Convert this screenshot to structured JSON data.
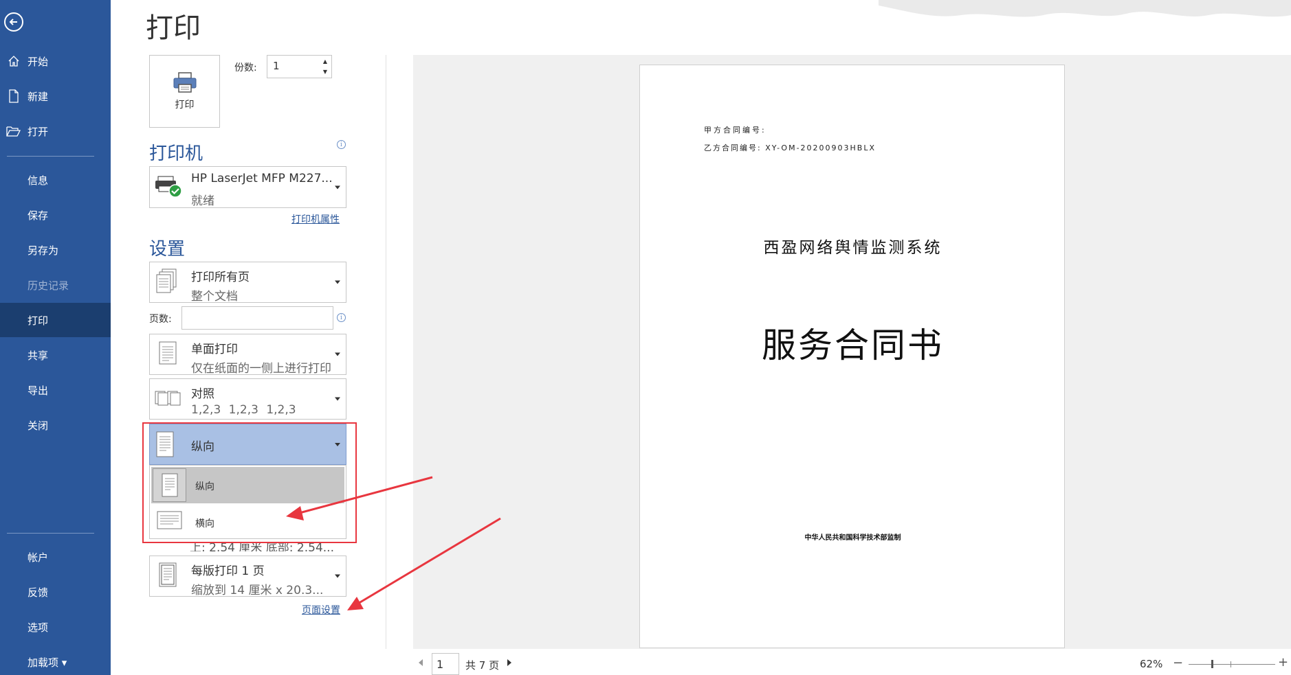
{
  "sidebar": {
    "items": [
      {
        "label": "开始"
      },
      {
        "label": "新建"
      },
      {
        "label": "打开"
      },
      {
        "label": "信息"
      },
      {
        "label": "保存"
      },
      {
        "label": "另存为"
      },
      {
        "label": "历史记录"
      },
      {
        "label": "打印"
      },
      {
        "label": "共享"
      },
      {
        "label": "导出"
      },
      {
        "label": "关闭"
      },
      {
        "label": "帐户"
      },
      {
        "label": "反馈"
      },
      {
        "label": "选项"
      },
      {
        "label": "加载项 ▾"
      }
    ]
  },
  "main": {
    "title": "打印",
    "print_button": "打印",
    "copies_label": "份数:",
    "copies_value": "1"
  },
  "printer": {
    "section_title": "打印机",
    "name": "HP LaserJet MFP M227...",
    "status": "就绪",
    "properties_link": "打印机属性"
  },
  "settings": {
    "section_title": "设置",
    "pages_label": "页数:",
    "pages_value": "",
    "range": {
      "line1": "打印所有页",
      "line2": "整个文档"
    },
    "sides": {
      "line1": "单面打印",
      "line2": "仅在纸面的一侧上进行打印"
    },
    "collate": {
      "line1": "对照",
      "line2": "1,2,3    1,2,3    1,2,3"
    },
    "orientation": {
      "selected": "纵向",
      "options": [
        "纵向",
        "横向"
      ]
    },
    "margins_partial": "上: 2.54 厘米 底部: 2.54...",
    "per_sheet": {
      "line1": "每版打印 1 页",
      "line2": "缩放到 14 厘米 x 20.3..."
    },
    "page_setup_link": "页面设置"
  },
  "preview": {
    "party_a": "甲方合同编号:",
    "party_b": "乙方合同编号: XY-OM-20200903HBLX",
    "system_name": "西盈网络舆情监测系统",
    "title": "服务合同书",
    "footer": "中华人民共和国科学技术部监制"
  },
  "navigation": {
    "current_page": "1",
    "total_pages": "共 7 页",
    "zoom": "62%"
  },
  "colors": {
    "sidebar": "#2b579a",
    "sidebar_active": "#1b3e6f",
    "accent": "#2b579a",
    "annotation": "#e8363f",
    "selected_dropdown": "#a9c0e4"
  },
  "icons": [
    "back-arrow-icon",
    "home-icon",
    "new-document-icon",
    "open-folder-icon",
    "printer-icon",
    "printer-ready-icon",
    "info-icon",
    "pages-icon",
    "single-sided-icon",
    "collate-icon",
    "portrait-icon",
    "landscape-icon",
    "pages-per-sheet-icon"
  ]
}
